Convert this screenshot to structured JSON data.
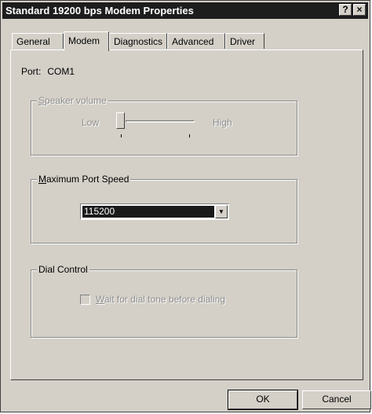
{
  "window": {
    "title": "Standard 19200 bps Modem Properties",
    "help_glyph": "?",
    "close_glyph": "×"
  },
  "tabs": [
    {
      "label": "General",
      "active": false
    },
    {
      "label": "Modem",
      "active": true
    },
    {
      "label": "Diagnostics",
      "active": false
    },
    {
      "label": "Advanced",
      "active": false
    },
    {
      "label": "Driver",
      "active": false
    }
  ],
  "port": {
    "label": "Port:",
    "value": "COM1"
  },
  "speaker": {
    "legend_mnemonic": "S",
    "legend_rest": "peaker volume",
    "low_label": "Low",
    "high_label": "High",
    "level": 0,
    "disabled": true
  },
  "max_speed": {
    "legend_mnemonic": "M",
    "legend_rest": "aximum Port Speed",
    "selected": "115200",
    "arrow_glyph": "▼"
  },
  "dial_control": {
    "legend": "Dial Control",
    "checkbox_mnemonic": "W",
    "checkbox_rest": "ait for dial tone before dialing",
    "checked": false,
    "disabled": true
  },
  "buttons": {
    "ok": "OK",
    "cancel": "Cancel"
  }
}
